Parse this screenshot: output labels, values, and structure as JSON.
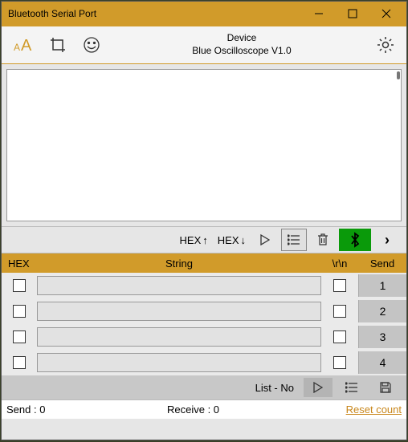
{
  "title": "Bluetooth Serial Port",
  "device": {
    "label": "Device",
    "name": "Blue Oscilloscope V1.0"
  },
  "toolbar2": {
    "hex_up": "HEX",
    "hex_down": "HEX"
  },
  "columns": {
    "hex": "HEX",
    "string": "String",
    "rn": "\\r\\n",
    "send": "Send"
  },
  "rows": [
    {
      "value": "",
      "send": "1"
    },
    {
      "value": "",
      "send": "2"
    },
    {
      "value": "",
      "send": "3"
    },
    {
      "value": "",
      "send": "4"
    }
  ],
  "footer": {
    "list_no": "List - No"
  },
  "status": {
    "send": "Send :  0",
    "receive": "Receive :  0",
    "reset": "Reset count"
  }
}
